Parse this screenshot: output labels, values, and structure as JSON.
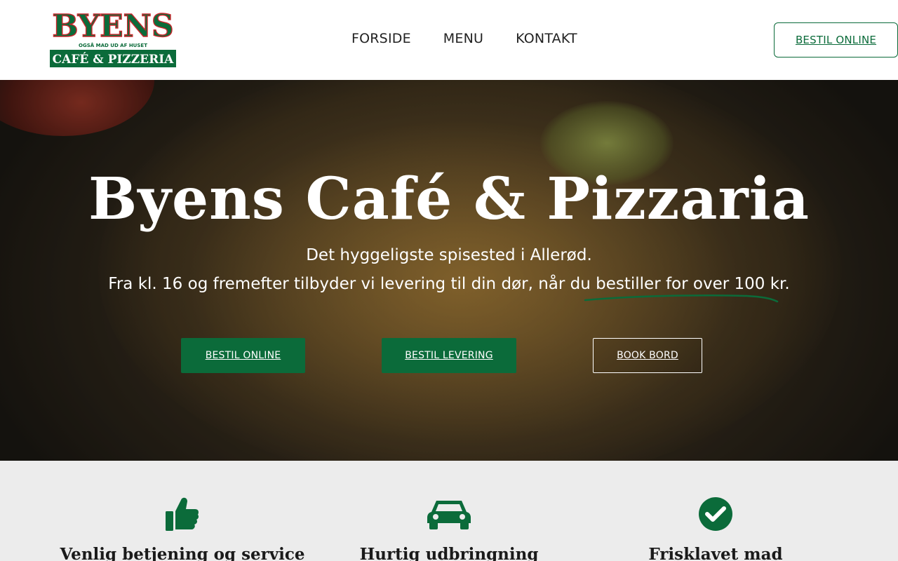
{
  "brand": {
    "logo_text_top": "BYENS",
    "logo_tagline": "OGSÅ MAD UD AF HUSET",
    "logo_text_bottom": "CAFÉ & PIZZERIA",
    "color_primary": "#0b6b3a",
    "color_accent": "#c8262c"
  },
  "nav": {
    "items": [
      {
        "label": "FORSIDE"
      },
      {
        "label": "MENU"
      },
      {
        "label": "KONTAKT"
      }
    ],
    "cta_label": "BESTIL ONLINE"
  },
  "hero": {
    "title": "Byens Café & Pizzaria",
    "subtitle_line1": "Det hyggeligste spisested i Allerød.",
    "subtitle_line2": "Fra kl. 16 og fremefter tilbyder vi levering til din dør, når du bestiller for over 100 kr.",
    "buttons": [
      {
        "label": "BESTIL ONLINE"
      },
      {
        "label": "BESTIL LEVERING"
      },
      {
        "label": "BOOK BORD"
      }
    ]
  },
  "features": [
    {
      "icon": "thumbs-up-icon",
      "title": "Venlig betjening og service"
    },
    {
      "icon": "car-icon",
      "title": "Hurtig udbringning"
    },
    {
      "icon": "check-circle-icon",
      "title": "Frisklavet mad"
    }
  ]
}
